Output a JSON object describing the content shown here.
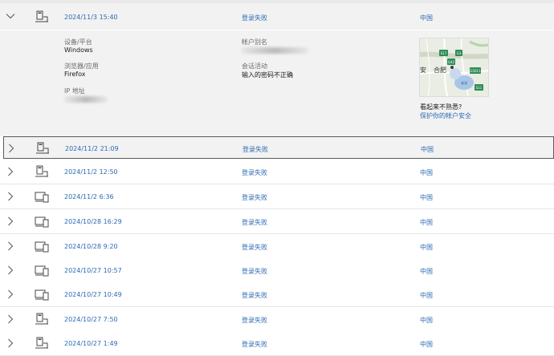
{
  "expanded": {
    "date": "2024/11/3 15:40",
    "status": "登录失败",
    "country": "中国",
    "device_icon": "desktop-icon",
    "details": {
      "device_label": "设备/平台",
      "device_value": "Windows",
      "browser_label": "浏览器/应用",
      "browser_value": "Firefox",
      "ip_label": "IP 地址",
      "alias_label": "帐户别名",
      "activity_label": "会话活动",
      "activity_value": "输入的密码不正确",
      "map_city": "合肥",
      "map_city_partial": "安",
      "map_lake": "巢湖",
      "map_shields": [
        "S17",
        "G3",
        "G42",
        "G5011",
        "S11"
      ],
      "unfamiliar_text": "看起来不熟悉?",
      "protect_link": "保护你的帐户安全"
    }
  },
  "rows": [
    {
      "date": "2024/11/2 21:09",
      "status": "登录失败",
      "country": "中国",
      "device": "desktop-icon"
    },
    {
      "date": "2024/11/2 12:50",
      "status": "登录失败",
      "country": "中国",
      "device": "desktop-icon"
    },
    {
      "date": "2024/11/2 6:36",
      "status": "登录失败",
      "country": "中国",
      "device": "multi-device-icon"
    },
    {
      "date": "2024/10/28 16:29",
      "status": "登录失败",
      "country": "中国",
      "device": "multi-device-icon"
    },
    {
      "date": "2024/10/28 9:20",
      "status": "登录失败",
      "country": "中国",
      "device": "multi-device-icon"
    },
    {
      "date": "2024/10/27 10:57",
      "status": "登录失败",
      "country": "中国",
      "device": "multi-device-icon"
    },
    {
      "date": "2024/10/27 10:49",
      "status": "登录失败",
      "country": "中国",
      "device": "multi-device-icon"
    },
    {
      "date": "2024/10/27 7:50",
      "status": "登录失败",
      "country": "中国",
      "device": "desktop-icon"
    },
    {
      "date": "2024/10/27 1:49",
      "status": "登录失败",
      "country": "中国",
      "device": "desktop-icon"
    }
  ],
  "colors": {
    "link": "#2b6ab3",
    "expanded_bg": "#f2f2f2",
    "divider": "#e6e6e6"
  }
}
